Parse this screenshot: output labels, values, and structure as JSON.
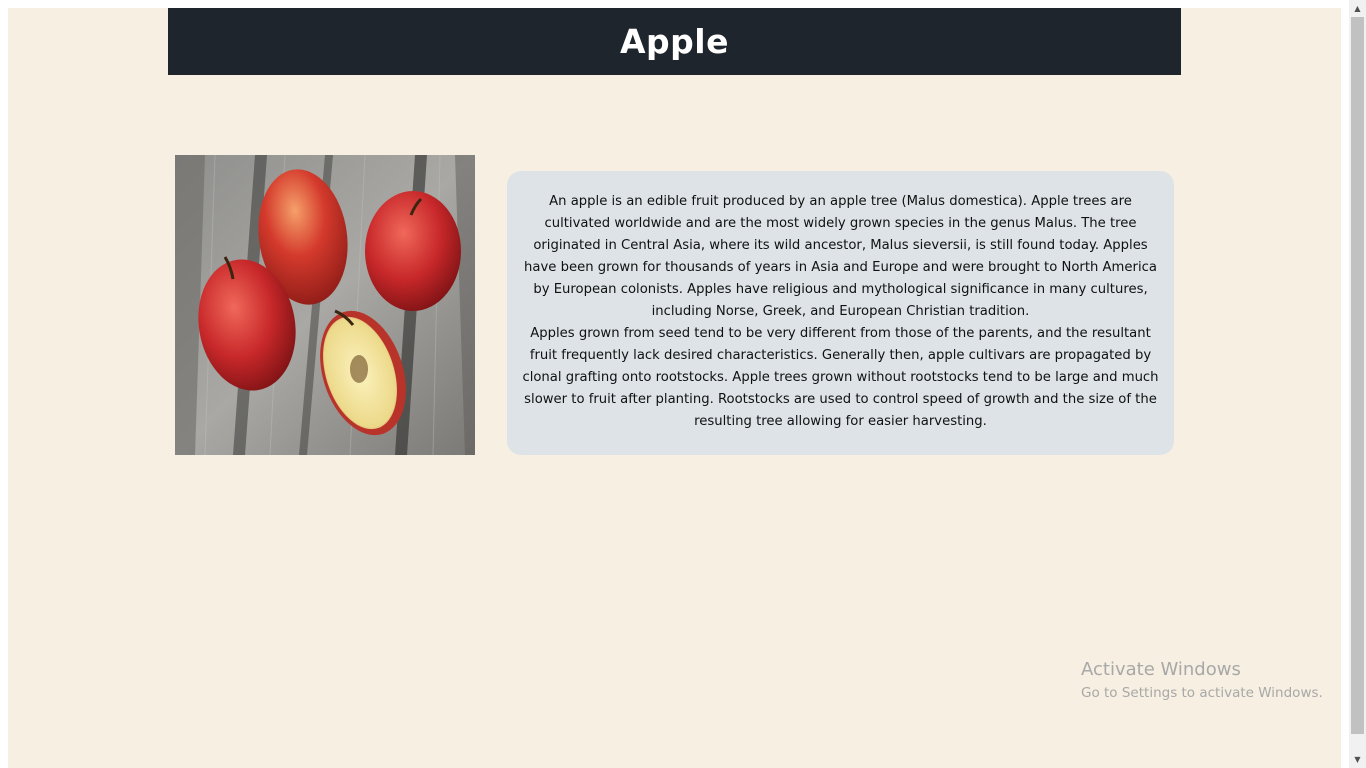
{
  "page": {
    "title": "Apple",
    "image_alt": "Red apples and a halved apple on weathered wooden planks",
    "paragraphs": [
      "An apple is an edible fruit produced by an apple tree (Malus domestica). Apple trees are cultivated worldwide and are the most widely grown species in the genus Malus. The tree originated in Central Asia, where its wild ancestor, Malus sieversii, is still found today. Apples have been grown for thousands of years in Asia and Europe and were brought to North America by European colonists. Apples have religious and mythological significance in many cultures, including Norse, Greek, and European Christian tradition.",
      "Apples grown from seed tend to be very different from those of the parents, and the resultant fruit frequently lack desired characteristics. Generally then, apple cultivars are propagated by clonal grafting onto rootstocks. Apple trees grown without rootstocks tend to be large and much slower to fruit after planting. Rootstocks are used to control speed of growth and the size of the resulting tree allowing for easier harvesting."
    ]
  },
  "watermark": {
    "title": "Activate Windows",
    "subtitle": "Go to Settings to activate Windows."
  },
  "scrollbar": {
    "up_icon": "chevron-up-icon",
    "down_icon": "chevron-down-icon"
  },
  "colors": {
    "page_bg": "#f6efe2",
    "header_bg": "#1f252c",
    "textbox_bg": "#dde3e6",
    "apple_red": "#c8282a"
  }
}
